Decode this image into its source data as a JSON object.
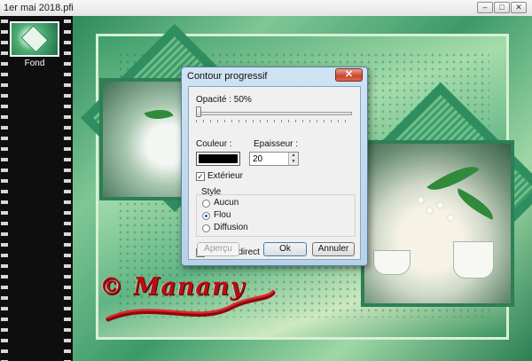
{
  "window": {
    "title": "1er mai 2018.pfi",
    "controls": {
      "minimize": "–",
      "restore": "□",
      "close": "✕"
    }
  },
  "layers": [
    {
      "label": "Fond"
    }
  ],
  "artwork": {
    "signature": "© Manany"
  },
  "dialog": {
    "title": "Contour progressif",
    "close_label": "✕",
    "opacity_label": "Opacité : 50%",
    "opacity_value": 50,
    "color_label": "Couleur :",
    "color_value": "#000000",
    "thickness_label": "Epaisseur :",
    "thickness_value": "20",
    "exterior_label": "Extérieur",
    "exterior_checked": true,
    "style_label": "Style",
    "style_options": [
      "Aucun",
      "Flou",
      "Diffusion"
    ],
    "style_selected": "Flou",
    "live_preview_label": "Aperçu direct",
    "live_preview_checked": true,
    "buttons": {
      "preview": "Aperçu",
      "ok": "Ok",
      "cancel": "Annuler"
    }
  }
}
